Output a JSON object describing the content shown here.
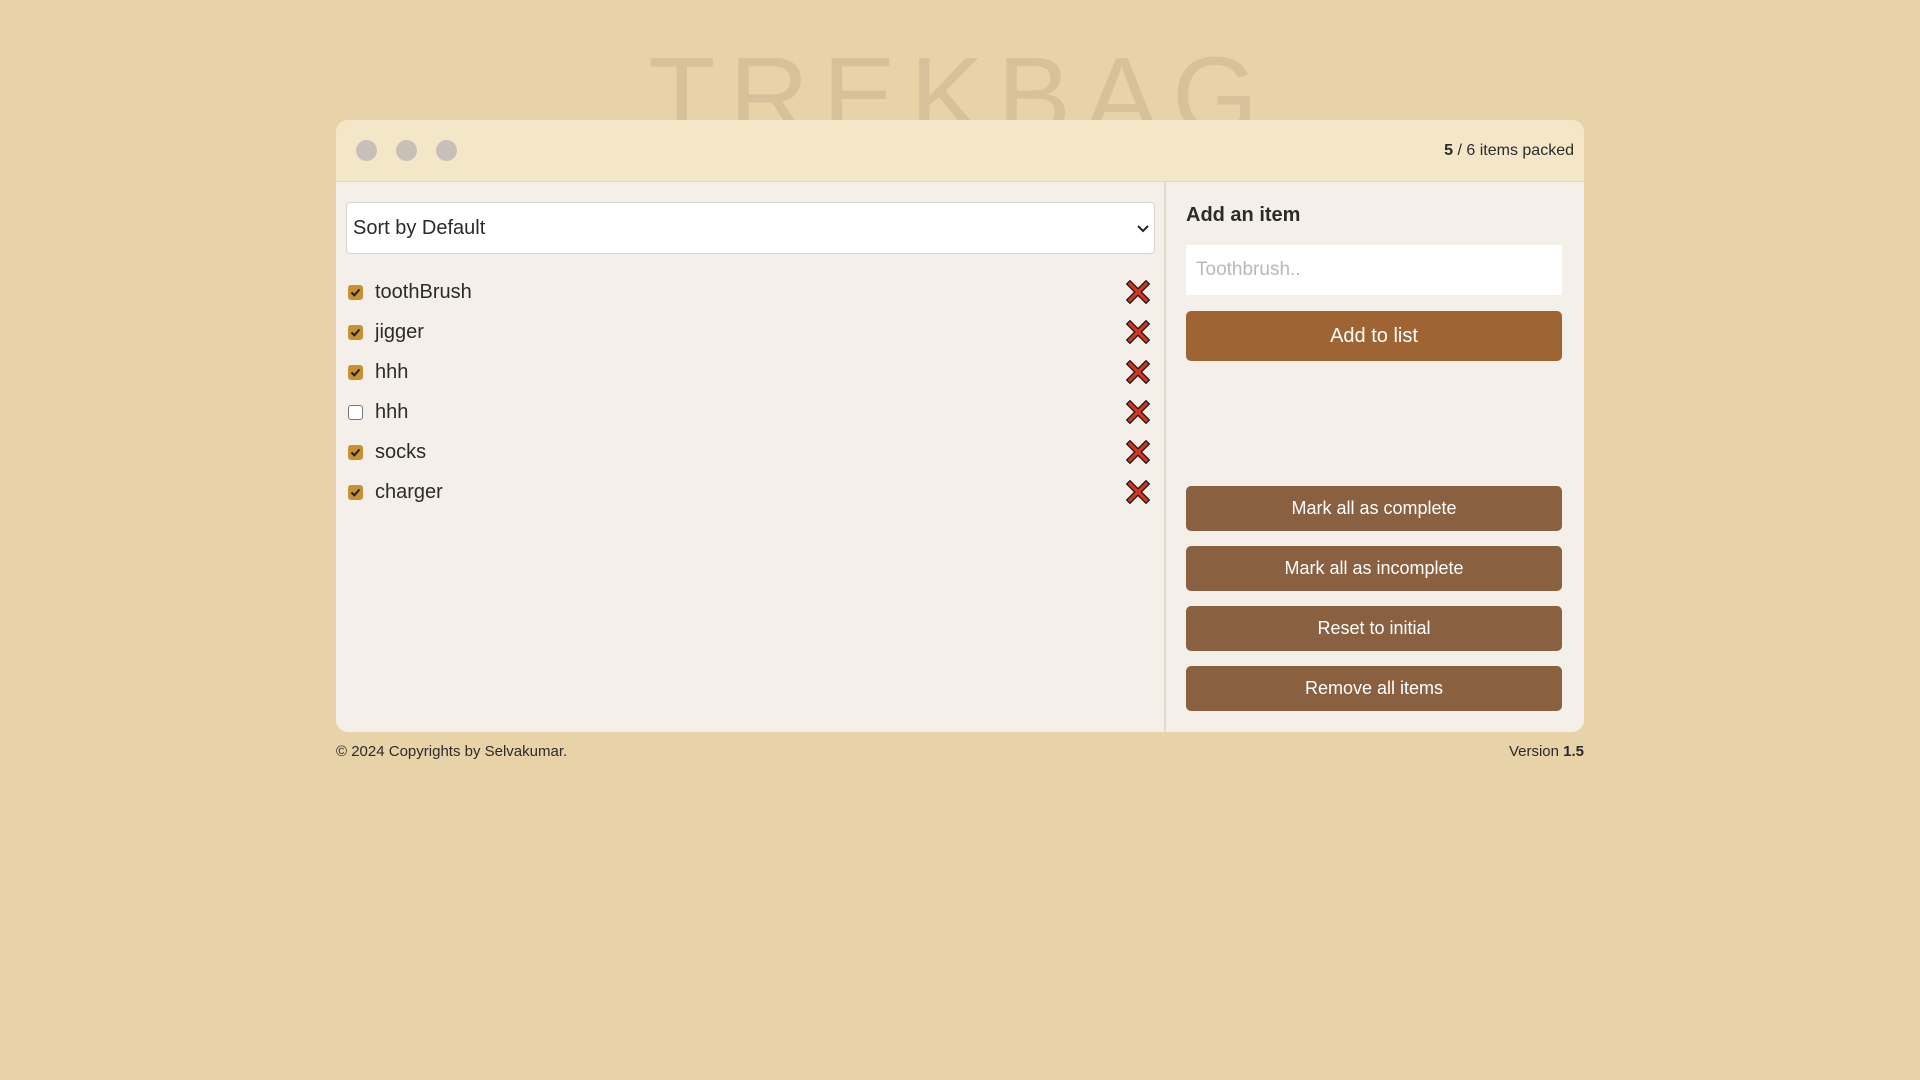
{
  "logo": {
    "text": "TREKBAG"
  },
  "header": {
    "packed_count": "5",
    "total_text": " / 6 items packed"
  },
  "sort": {
    "selected": "Sort by Default"
  },
  "items": [
    {
      "label": "toothBrush",
      "checked": true
    },
    {
      "label": "jigger",
      "checked": true
    },
    {
      "label": "hhh",
      "checked": true
    },
    {
      "label": "hhh",
      "checked": false
    },
    {
      "label": "socks",
      "checked": true
    },
    {
      "label": "charger",
      "checked": true
    }
  ],
  "add": {
    "title": "Add an item",
    "placeholder": "Toothbrush..",
    "button": "Add to list"
  },
  "actions": {
    "mark_complete": "Mark all as complete",
    "mark_incomplete": "Mark all as incomplete",
    "reset": "Reset to initial",
    "remove_all": "Remove all items"
  },
  "footer": {
    "copyright": "© 2024 Copyrights by Selvakumar.",
    "version_label": "Version ",
    "version_number": "1.5"
  },
  "colors": {
    "background": "#e7d3a7",
    "primary_button": "#9e6433",
    "secondary_button": "#8a6140",
    "checkbox": "#c69132",
    "delete_icon": "#d7331f"
  },
  "icons": {
    "delete": "close-x-icon",
    "dropdown": "chevron-down-icon",
    "check": "check-icon"
  }
}
